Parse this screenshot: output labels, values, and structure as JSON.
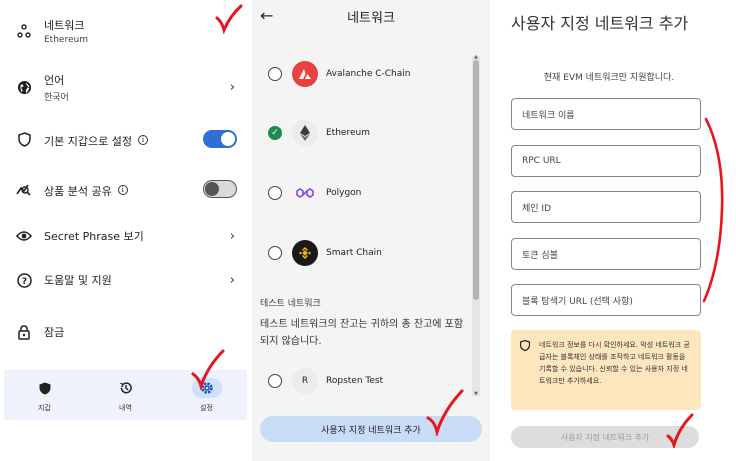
{
  "settings": {
    "items": [
      {
        "title": "네트워크",
        "subtitle": "Ethereum",
        "icon": "network-nodes-icon"
      },
      {
        "title": "언어",
        "subtitle": "한국어",
        "icon": "globe-icon"
      },
      {
        "title": "기본 지갑으로 설정",
        "icon": "shield-icon",
        "toggle": true
      },
      {
        "title": "상품 분석 공유",
        "icon": "analytics-icon",
        "toggle": false
      },
      {
        "title": "Secret Phrase 보기",
        "icon": "eye-icon"
      },
      {
        "title": "도움말 및 지원",
        "icon": "help-icon"
      },
      {
        "title": "잠금",
        "icon": "lock-icon"
      }
    ],
    "bottom_nav": {
      "tabs": [
        {
          "label": "지갑",
          "icon": "shield-wallet-icon"
        },
        {
          "label": "내역",
          "icon": "history-icon"
        },
        {
          "label": "설정",
          "icon": "gear-icon",
          "active": true
        }
      ]
    }
  },
  "network_select": {
    "title": "네트워크",
    "networks": [
      {
        "name": "Avalanche C-Chain",
        "checked": false,
        "icon": "avalanche-icon",
        "color": "#e84142"
      },
      {
        "name": "Ethereum",
        "checked": true,
        "icon": "ethereum-icon",
        "color": "#3c3c3d"
      },
      {
        "name": "Polygon",
        "checked": false,
        "icon": "polygon-icon",
        "color": "#8247e5"
      },
      {
        "name": "Smart Chain",
        "checked": false,
        "icon": "bnb-icon",
        "color": "#f0b90b"
      }
    ],
    "test_section": {
      "heading": "테스트 네트워크",
      "description": "테스트 네트워크의 잔고는 귀하의 총 잔고에 포함되지 않습니다.",
      "networks": [
        {
          "name": "Ropsten Test",
          "badge": "R",
          "checked": false
        }
      ]
    },
    "cta_label": "사용자 지정 네트워크 추가"
  },
  "add_network": {
    "title": "사용자 지정 네트워크 추가",
    "subtitle": "현재 EVM 네트워크만 지원합니다.",
    "fields": [
      {
        "placeholder": "네트워크 이름"
      },
      {
        "placeholder": "RPC URL"
      },
      {
        "placeholder": "체인 ID"
      },
      {
        "placeholder": "토큰 심볼"
      },
      {
        "placeholder": "블록 탐색기 URL (선택 사항)"
      }
    ],
    "notice": "네트워크 정보를 다시 확인하세요. 악성 네트워크 공급자는 블록체인 상태를 조작하고 네트워크 활동을 기록할 수 있습니다. 신뢰할 수 있는 사용자 지정 네트워크만 추가하세요.",
    "cta_label": "사용자 지정 네트워크 추가",
    "cta_enabled": false
  },
  "colors": {
    "accent": "#2f6fd4",
    "check_green": "#1e8a4f",
    "notice_bg": "#fde6bd",
    "annotation_red": "#e8151b"
  }
}
